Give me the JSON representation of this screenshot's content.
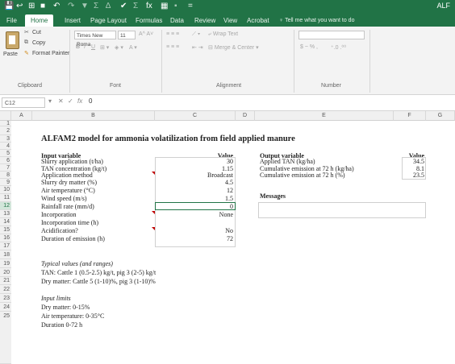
{
  "title_bar": {
    "app_title": "ALF",
    "quick_access": [
      "💾",
      "↩",
      "⊞",
      "■",
      "↶",
      "↷",
      "▼",
      "Σ",
      "∆",
      "✔",
      "Σ",
      "fx",
      "▦",
      "▪",
      "="
    ]
  },
  "ribbon_tabs": [
    "File",
    "Home",
    "Insert",
    "Page Layout",
    "Formulas",
    "Data",
    "Review",
    "View",
    "Acrobat"
  ],
  "tell_me": "Tell me what you want to do",
  "clipboard": {
    "paste": "Paste",
    "cut": "Cut",
    "copy": "Copy",
    "format_painter": "Format Painter",
    "label": "Clipboard"
  },
  "font_group": {
    "font_name": "Times New Roma",
    "font_size": "11",
    "label": "Font"
  },
  "alignment_group": {
    "wrap_text": "Wrap Text",
    "merge": "Merge & Center",
    "label": "Alignment"
  },
  "number_group": {
    "label": "Number",
    "format": "$ ~ % ,",
    "decimals": "⁺.0 .⁰⁰"
  },
  "formula_bar": {
    "name_box": "C12",
    "formula": "0"
  },
  "columns": [
    "A",
    "B",
    "C",
    "D",
    "E",
    "F",
    "G"
  ],
  "rows": [
    "1",
    "2",
    "3",
    "4",
    "5",
    "6",
    "7",
    "8",
    "9",
    "10",
    "11",
    "12",
    "13",
    "14",
    "15",
    "16",
    "17",
    "18",
    "19",
    "20",
    "21",
    "22",
    "23",
    "24",
    "25"
  ],
  "sheet": {
    "title": "ALFAM2 model for ammonia volatilization from field applied manure",
    "input_header": "Input variable",
    "value_header": "Value",
    "inputs": [
      {
        "label": "Slurry application (t/ha)",
        "value": "30"
      },
      {
        "label": "TAN concentration (kg/t)",
        "value": "1.15"
      },
      {
        "label": "Application method",
        "value": "Broadcast"
      },
      {
        "label": "Slurry dry matter (%)",
        "value": "4.5"
      },
      {
        "label": "Air temperature (°C)",
        "value": "12"
      },
      {
        "label": "Wind speed (m/s)",
        "value": "1.5"
      },
      {
        "label": "Rainfall rate (mm/d)",
        "value": "0"
      },
      {
        "label": "Incorporation",
        "value": "None"
      },
      {
        "label": "Incorporation time (h)",
        "value": ""
      },
      {
        "label": "Acidification?",
        "value": "No"
      },
      {
        "label": "Duration of emission (h)",
        "value": "72"
      }
    ],
    "output_header": "Output variable",
    "output_value_header": "Value",
    "outputs": [
      {
        "label": "Applied TAN (kg/ha)",
        "value": "34.5"
      },
      {
        "label": "Cumulative emission at 72 h (kg/ha)",
        "value": "8.1"
      },
      {
        "label": "Cumulative emission at 72 h (%)",
        "value": "23.5"
      }
    ],
    "messages_label": "Messages",
    "typical_header": "Typical values (and ranges)",
    "typical_tan": "TAN: Cattle 1 (0.5-2.5) kg/t, pig 3 (2-5) kg/t",
    "typical_dm": "Dry matter: Cattle 5 (1-10)%, pig 3 (1-10)%",
    "limits_header": "Input limits",
    "limit_dm": "Dry matter: 0-15%",
    "limit_air": "Air temperature: 0-35°C",
    "limit_duration": "Duration 0-72 h"
  },
  "colors": {
    "excel_green": "#217346",
    "selected_border": "#217346",
    "comment_marker": "#c00000"
  }
}
